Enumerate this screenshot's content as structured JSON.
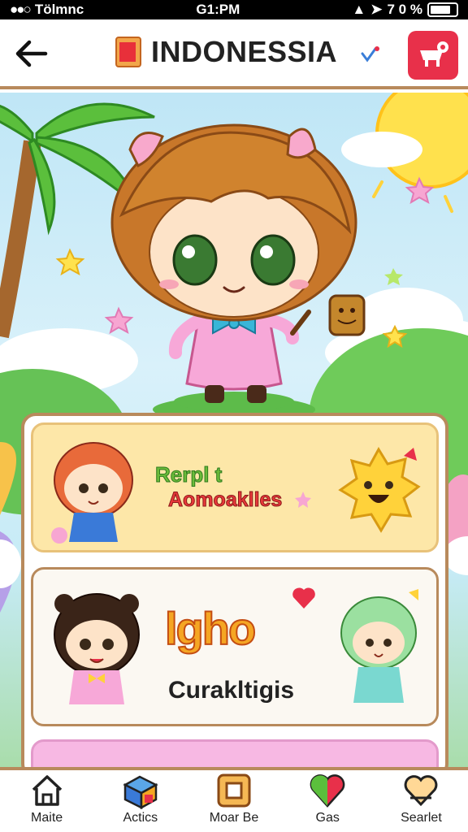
{
  "status_bar": {
    "carrier": "Tölmnc",
    "time": "G1:PM",
    "right_text": "7 0 %"
  },
  "header": {
    "title": "INDONESSIA",
    "back_icon": "back-arrow-icon",
    "action_icon": "cart-icon",
    "colors": {
      "accent": "#e8304a",
      "border": "#b88a5c"
    }
  },
  "cards": [
    {
      "title_line_1": "Rerpl t",
      "title_line_2": "Aomoaklles",
      "background": "#fde7a8"
    },
    {
      "logo_text": "lgho",
      "name": "Curakltigis",
      "background": "#fbf8f2"
    },
    {
      "background": "#f7b8e3"
    }
  ],
  "bottom_nav": {
    "items": [
      {
        "label": "Maite",
        "icon": "home-icon"
      },
      {
        "label": "Actics",
        "icon": "box-icon"
      },
      {
        "label": "Moar Be",
        "icon": "square-icon"
      },
      {
        "label": "Gas",
        "icon": "heart-icon"
      },
      {
        "label": "Searlet",
        "icon": "heart-outline-icon"
      }
    ]
  }
}
